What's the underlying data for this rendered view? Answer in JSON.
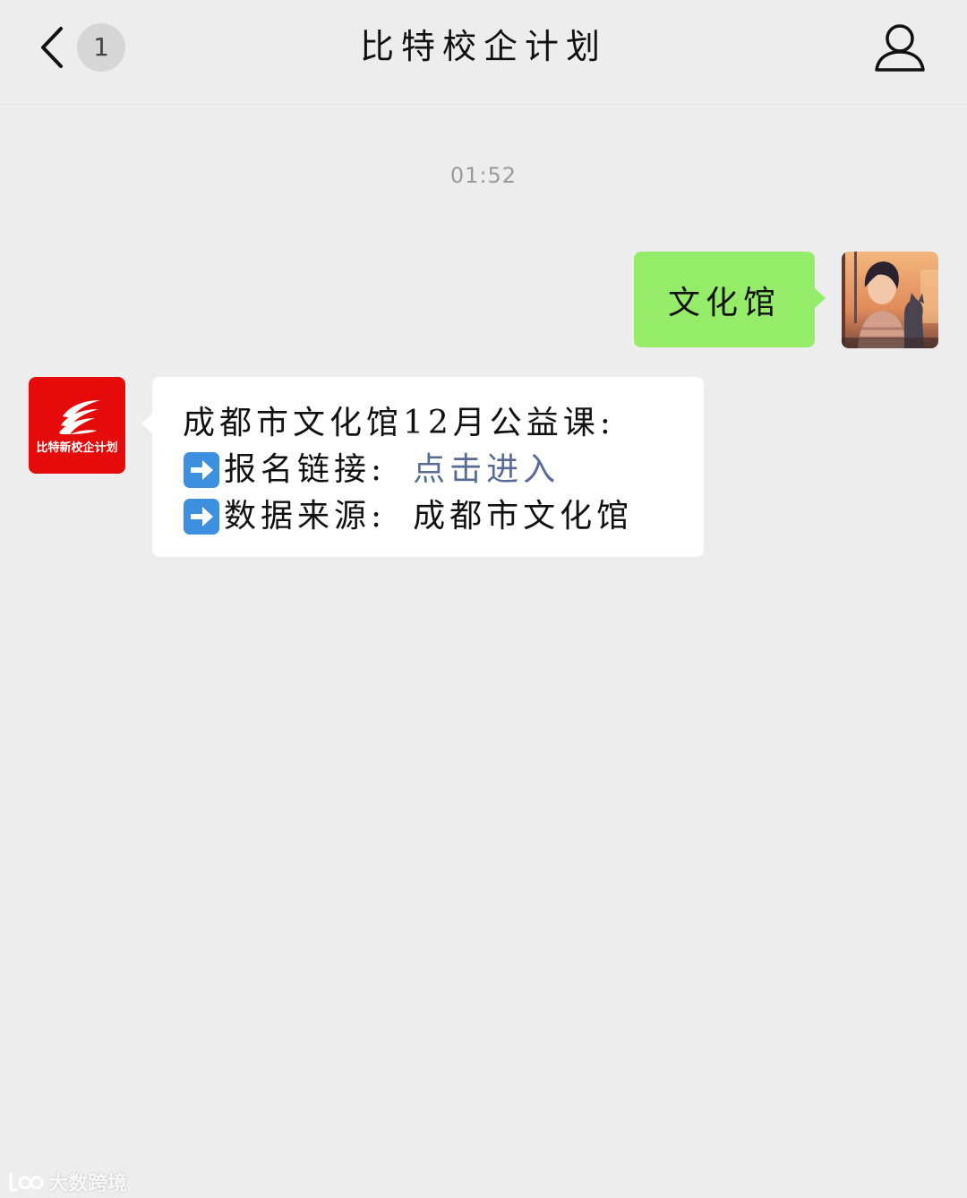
{
  "header": {
    "title": "比特校企计划",
    "unread_count": "1",
    "back_icon": "chevron-left-icon",
    "profile_icon": "person-icon"
  },
  "chat": {
    "timestamp": "01:52",
    "sent_message": {
      "text": "文化馆",
      "bubble_color": "#95EC69"
    },
    "received_message": {
      "line1": "成都市文化馆12月公益课:",
      "line2_label": "报名链接:",
      "line2_link": "点击进入",
      "line3_label": "数据来源:",
      "line3_value": "成都市文化馆",
      "link_color": "#576B95"
    },
    "brand_avatar": {
      "label": "比特新校企计划",
      "color": "#E50B0B"
    }
  },
  "watermark": {
    "text": "大数跨境"
  }
}
